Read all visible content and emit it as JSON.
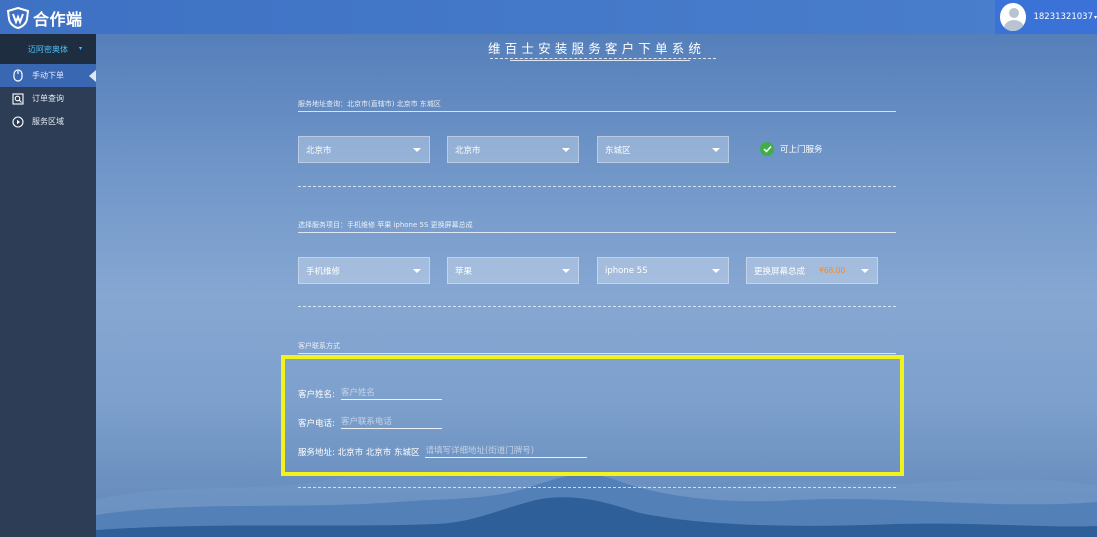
{
  "app": {
    "logo_text": "合作端"
  },
  "user": {
    "name": "18231321037",
    "caret": "▾"
  },
  "sidebar": {
    "shop_select": {
      "label": "迈阿密奥体",
      "caret": "▾"
    },
    "items": [
      {
        "label": "手动下单",
        "icon": "mouse-icon",
        "active": true
      },
      {
        "label": "订单查询",
        "icon": "search-doc-icon",
        "active": false
      },
      {
        "label": "服务区域",
        "icon": "play-circle-icon",
        "active": false
      }
    ]
  },
  "main": {
    "title": "维百士安装服务客户下单系统",
    "address_section": {
      "label": "服务地址查询：北京市(直辖市) 北京市 东城区",
      "province": "北京市",
      "city": "北京市",
      "district": "东城区",
      "service_available_label": "可上门服务"
    },
    "service_section": {
      "label": "选择服务项目：手机维修 苹果 iphone 5S 更换屏幕总成",
      "category": "手机维修",
      "brand": "苹果",
      "model": "iphone 5S",
      "item": "更换屏幕总成",
      "price": "¥68.00"
    },
    "contact_section": {
      "label": "客户联系方式",
      "name_label": "客户姓名:",
      "name_placeholder": "客户姓名",
      "phone_label": "客户电话:",
      "phone_placeholder": "客户联系电话",
      "address_label": "服务地址: 北京市 北京市 东城区",
      "address_placeholder": "请填写详细地址(街道门牌号)"
    }
  },
  "colors": {
    "topbar": "#3e71c3",
    "sidebar": "#2c3d55",
    "active_menu": "#3a67b2",
    "highlight": "#f2f21c",
    "check_green": "#3fae49",
    "price_orange": "#f28c28"
  }
}
